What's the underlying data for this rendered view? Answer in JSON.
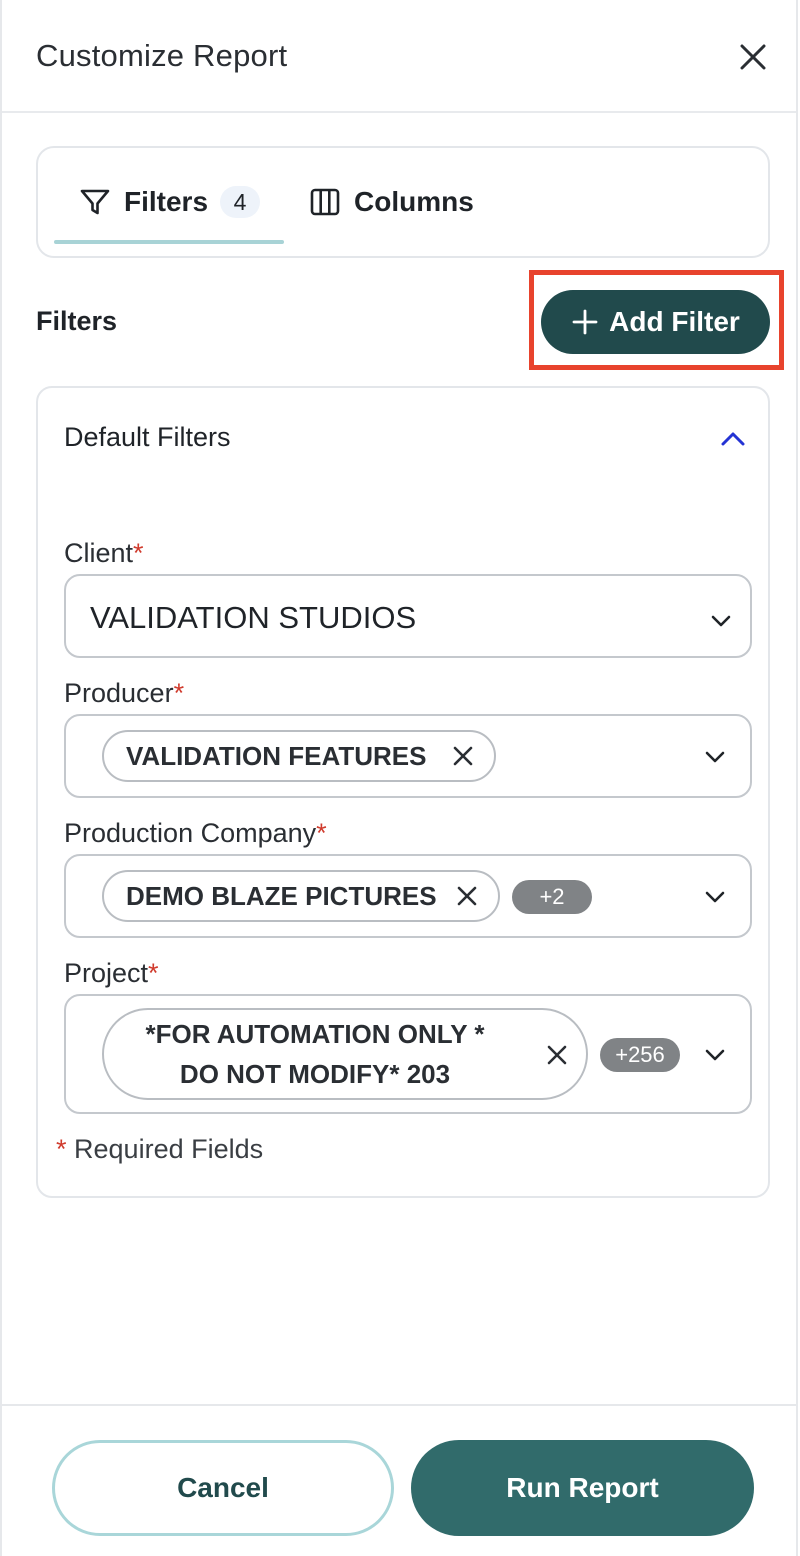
{
  "header": {
    "title": "Customize Report"
  },
  "tabs": [
    {
      "label": "Filters",
      "count": "4",
      "icon": "filter-icon"
    },
    {
      "label": "Columns",
      "icon": "columns-icon"
    }
  ],
  "filters_section": {
    "label": "Filters",
    "add_button_label": "Add Filter"
  },
  "default_filters": {
    "title": "Default Filters",
    "fields": {
      "client": {
        "label": "Client",
        "required_mark": "*",
        "value": "VALIDATION STUDIOS"
      },
      "producer": {
        "label": "Producer",
        "required_mark": "*",
        "chip": "VALIDATION FEATURES"
      },
      "production_company": {
        "label": "Production Company",
        "required_mark": "*",
        "chip": "DEMO BLAZE PICTURES",
        "more": "+2"
      },
      "project": {
        "label": "Project",
        "required_mark": "*",
        "chip_line1": "*FOR AUTOMATION ONLY *",
        "chip_line2": "DO NOT MODIFY* 203",
        "more": "+256"
      }
    },
    "required_note": {
      "mark": "*",
      "text": "Required Fields"
    }
  },
  "footer": {
    "cancel_label": "Cancel",
    "run_label": "Run Report"
  },
  "colors": {
    "primary_dark": "#214a4c",
    "primary": "#316b6b",
    "accent_outline": "#a9d6d9",
    "required": "#d03b2d",
    "highlight": "#e8432d"
  }
}
